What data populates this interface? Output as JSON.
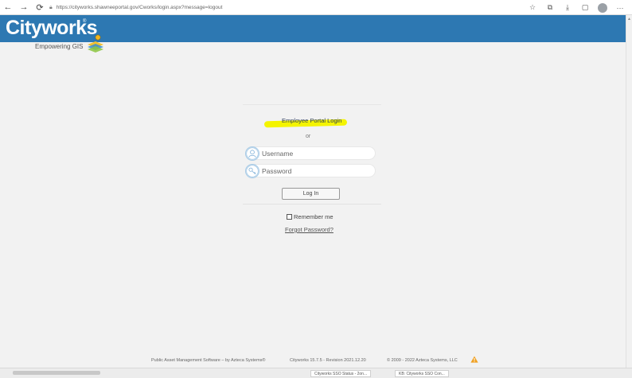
{
  "browser": {
    "back_icon": "←",
    "forward_icon": "→",
    "reload_icon": "⟳",
    "url": "https://cityworks.shawneeportal.gov/Cworks/login.aspx?message=logout",
    "menu_icon": "···"
  },
  "header": {
    "logo": "Cityworks",
    "logo_reg": "®",
    "tagline": "Empowering GIS",
    "background_color": "#2d78b2"
  },
  "login": {
    "portal_link": "Employee Portal Login",
    "or_text": "or",
    "username_placeholder": "Username",
    "password_placeholder": "Password",
    "login_button": "Log In",
    "remember_label": "Remember me",
    "forgot_link": "Forgot Password?",
    "highlight_color": "#f4f400"
  },
  "footer": {
    "left": "Public Asset Management Software – by Azteca Systems®",
    "center": "Cityworks 15.7.5 - Revision 2021.12.20",
    "right": "© 2009 - 2022 Azteca Systems, LLC"
  },
  "downloads": {
    "item1": "Cityworks SSO Status - 2on...",
    "item2": "KB: Cityworks SSO Con..."
  }
}
